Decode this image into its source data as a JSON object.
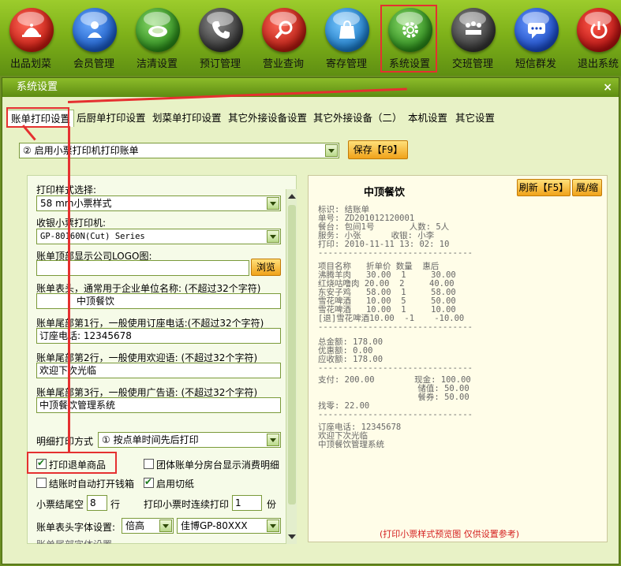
{
  "toolbar": [
    {
      "label": "出品划菜",
      "icon": "cloche-icon",
      "color": "#d42a1e"
    },
    {
      "label": "会员管理",
      "icon": "user-icon",
      "color": "#1e6ad4"
    },
    {
      "label": "洁清设置",
      "icon": "plate-icon",
      "color": "#3c9a2a"
    },
    {
      "label": "预订管理",
      "icon": "phone-icon",
      "color": "#444444"
    },
    {
      "label": "营业查询",
      "icon": "search-icon",
      "color": "#c82a1a"
    },
    {
      "label": "寄存管理",
      "icon": "bag-icon",
      "color": "#2a8ad4"
    },
    {
      "label": "系统设置",
      "icon": "gear-icon",
      "color": "#3c9a2a"
    },
    {
      "label": "交班管理",
      "icon": "meeting-icon",
      "color": "#444444"
    },
    {
      "label": "短信群发",
      "icon": "chat-icon",
      "color": "#1e5ad4"
    },
    {
      "label": "退出系统",
      "icon": "power-icon",
      "color": "#c81e1e"
    }
  ],
  "dialog": {
    "title": "系统设置",
    "close": "×"
  },
  "tabs": [
    "账单打印设置",
    "后厨单打印设置",
    "划菜单打印设置",
    "其它外接设备设置",
    "其它外接设备（二）",
    "本机设置",
    "其它设置"
  ],
  "top": {
    "mode_select": "② 启用小票打印机打印账单",
    "save_button": "保存【F9】"
  },
  "form": {
    "style_label": "打印样式选择:",
    "style_value": "58  mm小票样式",
    "printer_label": "收银小票打印机:",
    "printer_value": "GP-80160N(Cut) Series",
    "logo_label": "账单顶部显示公司LOGO图:",
    "logo_value": "",
    "browse_button": "浏览",
    "header_label": "账单表头，通常用于企业单位名称:  (不超过32个字符)",
    "header_value": "中顶餐饮",
    "footer1_label": "账单尾部第1行，一般使用订座电话:(不超过32个字符)",
    "footer1_value": "订座电话: 12345678",
    "footer2_label": "账单尾部第2行，一般使用欢迎语:  (不超过32个字符)",
    "footer2_value": "欢迎下次光临",
    "footer3_label": "账单尾部第3行，一般使用广告语:  (不超过32个字符)",
    "footer3_value": "中顶餐饮管理系统",
    "detail_label": "明细打印方式",
    "detail_value": "① 按点单时间先后打印",
    "chk_refund": "打印退单商品",
    "chk_group": "团体账单分房台显示消费明细",
    "chk_drawer": "结账时自动打开钱箱",
    "chk_cut": "启用切纸",
    "tail_label": "小票结尾空",
    "tail_value": "8",
    "tail_unit": "行",
    "copies_label": "打印小票时连续打印",
    "copies_value": "1",
    "copies_unit": "份",
    "font_label": "账单表头字体设置:",
    "font_size": "倍高",
    "font_printer": "佳博GP-80XXX",
    "cut_off_text": "账单尾部字体设置"
  },
  "preview": {
    "title": "中顶餐饮",
    "refresh_button": "刷新【F5】",
    "expand_button": "展/缩",
    "lines_top": "标识: 结账单\n单号: ZD201012120001\n餐台: 包间1号       人数: 5人\n服务: 小张      收银: 小李\n打印: 2010-11-11 13: 02: 10\n-------------------------------",
    "lines_items": "项目名称   折单价 数量  惠后\n沸腾羊肉   30.00  1     30.00\n红烧咕噜肉 20.00  2     40.00\n东安子鸡   58.00  1     58.00\n雪花啤酒   10.00  5     50.00\n雪花啤酒   10.00  1     10.00\n[退]雪花啤酒10.00  -1    -10.00\n-------------------------------",
    "lines_total": "总金额: 178.00\n优惠额: 0.00\n应收额: 178.00\n-------------------------------",
    "lines_pay": "支付: 200.00        现金: 100.00\n                    储值: 50.00\n                    餐券: 50.00\n找零: 22.00\n-------------------------------",
    "lines_footer": "订座电话: 12345678\n欢迎下次光临\n中顶餐饮管理系统",
    "note": "(打印小票样式预览图 仅供设置参考)"
  }
}
